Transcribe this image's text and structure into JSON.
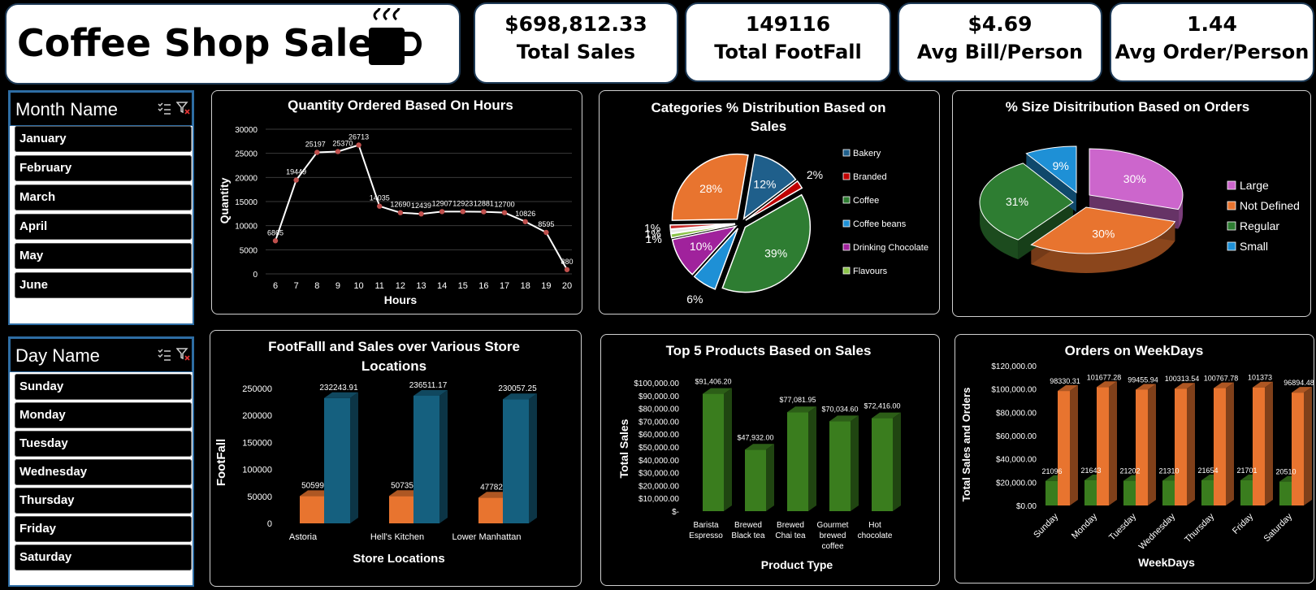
{
  "header": {
    "title": "Coffee Shop Sales",
    "icon": "coffee-cup-icon"
  },
  "kpis": [
    {
      "value": "$698,812.33",
      "label": "Total Sales"
    },
    {
      "value": "149116",
      "label": "Total  FootFall"
    },
    {
      "value": "$4.69",
      "label": "Avg Bill/Person"
    },
    {
      "value": "1.44",
      "label": "Avg Order/Person"
    }
  ],
  "month_slicer": {
    "title": "Month Name",
    "items": [
      "January",
      "February",
      "March",
      "April",
      "May",
      "June"
    ]
  },
  "day_slicer": {
    "title": "Day Name",
    "items": [
      "Sunday",
      "Monday",
      "Tuesday",
      "Wednesday",
      "Thursday",
      "Friday",
      "Saturday"
    ]
  },
  "chart_data": [
    {
      "type": "line",
      "title": "Quantity Ordered Based On Hours",
      "xlabel": "Hours",
      "ylabel": "Quantity",
      "x": [
        6,
        7,
        8,
        9,
        10,
        11,
        12,
        13,
        14,
        15,
        16,
        17,
        18,
        19,
        20
      ],
      "values": [
        6865,
        19449,
        25197,
        25370,
        26713,
        14035,
        12690,
        12439,
        12907,
        12923,
        12881,
        12700,
        10826,
        8595,
        880
      ],
      "data_labels": [
        "6865",
        "19449",
        "25197",
        "25370",
        "26713",
        "14035",
        "12690",
        "12439",
        "12907",
        "12923",
        "12881",
        "12700",
        "10826",
        "8595",
        "880"
      ],
      "ylim": [
        0,
        30000
      ],
      "yticks": [
        "0",
        "5000",
        "10000",
        "15000",
        "20000",
        "25000",
        "30000"
      ],
      "grid": true,
      "colors": {
        "line": "#ffffff",
        "marker": "#c0504d"
      }
    },
    {
      "type": "pie",
      "title_lines": [
        "Categories % Distribution Based on",
        "Sales"
      ],
      "slices": [
        {
          "name": "Bakery",
          "value": 12,
          "label": "12%",
          "color": "#1f5f8b"
        },
        {
          "name": "Branded",
          "value": 2,
          "label": "2%",
          "color": "#c00000"
        },
        {
          "name": "Coffee",
          "value": 39,
          "label": "39%",
          "color": "#2e7d32"
        },
        {
          "name": "Coffee beans",
          "value": 6,
          "label": "6%",
          "color": "#1e90d6"
        },
        {
          "name": "Drinking Chocolate",
          "value": 10,
          "label": "10%",
          "color": "#a0229c"
        },
        {
          "name": "Flavours",
          "value": 1,
          "label": "1%",
          "color": "#8bc34a"
        },
        {
          "name": "",
          "value": 1,
          "label": "1%",
          "color": "#e8e8e8"
        },
        {
          "name": "",
          "value": 1,
          "label": "1%",
          "color": "#c62828"
        },
        {
          "name": "",
          "value": 28,
          "label": "28%",
          "color": "#e8742f"
        }
      ],
      "legend": [
        "Bakery",
        "Branded",
        "Coffee",
        "Coffee beans",
        "Drinking Chocolate",
        "Flavours"
      ],
      "legend_colors": [
        "#1f5f8b",
        "#c00000",
        "#2e7d32",
        "#1e90d6",
        "#a0229c",
        "#8bc34a"
      ],
      "legend_position": "right"
    },
    {
      "type": "pie",
      "title": "% Size Disitribution Based on Orders",
      "slices": [
        {
          "name": "Large",
          "value": 30,
          "label": "30%",
          "color": "#cc66cc"
        },
        {
          "name": "Not Defined",
          "value": 30,
          "label": "30%",
          "color": "#e8742f"
        },
        {
          "name": "Regular",
          "value": 31,
          "label": "31%",
          "color": "#2e7d32"
        },
        {
          "name": "Small",
          "value": 9,
          "label": "9%",
          "color": "#1e90d6"
        }
      ],
      "legend": [
        "Large",
        "Not Defined",
        "Regular",
        "Small"
      ],
      "legend_position": "right"
    },
    {
      "type": "bar",
      "title_lines": [
        "FootFalll and Sales over Various Store",
        "Locations"
      ],
      "xlabel": "Store Locations",
      "ylabel": "FootFall",
      "categories": [
        "Astoria",
        "Hell's Kitchen",
        "Lower Manhattan"
      ],
      "series": [
        {
          "values": [
            50599,
            50735,
            47782
          ],
          "labels": [
            "50599",
            "50735",
            "47782"
          ],
          "color": "#e8742f"
        },
        {
          "values": [
            232243.91,
            236511.17,
            230057.25
          ],
          "labels": [
            "232243.91",
            "236511.17",
            "230057.25"
          ],
          "color": "#15607f"
        }
      ],
      "ylim": [
        0,
        250000
      ],
      "yticks": [
        "0",
        "50000",
        "100000",
        "150000",
        "200000",
        "250000"
      ]
    },
    {
      "type": "bar",
      "title": "Top 5 Products Based on Sales",
      "xlabel": "Product Type",
      "ylabel": "Total Sales",
      "categories": [
        [
          "Barista",
          "Espresso"
        ],
        [
          "Brewed",
          "Black tea"
        ],
        [
          "Brewed",
          "Chai tea"
        ],
        [
          "Gourmet",
          "brewed",
          "coffee"
        ],
        [
          "Hot",
          "chocolate"
        ]
      ],
      "values": [
        91406.2,
        47932.0,
        77081.95,
        70034.6,
        72416.0
      ],
      "labels": [
        "$91,406.20",
        "$47,932.00",
        "$77,081.95",
        "$70,034.60",
        "$72,416.00"
      ],
      "ylim": [
        0,
        100000
      ],
      "yticks": [
        "$-",
        "$10,000.00",
        "$20,000.00",
        "$30,000.00",
        "$40,000.00",
        "$50,000.00",
        "$60,000.00",
        "$70,000.00",
        "$80,000.00",
        "$90,000.00",
        "$100,000.00"
      ],
      "color": "#3a7d1e"
    },
    {
      "type": "bar",
      "title": "Orders on WeekDays",
      "xlabel": "WeekDays",
      "ylabel": "Total Sales and Orders",
      "categories": [
        "Sunday",
        "Monday",
        "Tuesday",
        "Wednesday",
        "Thursday",
        "Friday",
        "Saturday"
      ],
      "series": [
        {
          "values": [
            21096,
            21643,
            21202,
            21310,
            21654,
            21701,
            20510
          ],
          "labels": [
            "21096",
            "21643",
            "21202",
            "21310",
            "21654",
            "21701",
            "20510"
          ],
          "color": "#3a7d1e"
        },
        {
          "values": [
            98330.31,
            101677.28,
            99455.94,
            100313.54,
            100767.78,
            101373,
            96894.48
          ],
          "labels": [
            "98330.31",
            "101677.28",
            "99455.94",
            "100313.54",
            "100767.78",
            "101373",
            "96894.48"
          ],
          "color": "#e8742f"
        }
      ],
      "ylim": [
        0,
        120000
      ],
      "yticks": [
        "$0.00",
        "$20,000.00",
        "$40,000.00",
        "$60,000.00",
        "$80,000.00",
        "$100,000.00",
        "$120,000.00"
      ]
    }
  ]
}
